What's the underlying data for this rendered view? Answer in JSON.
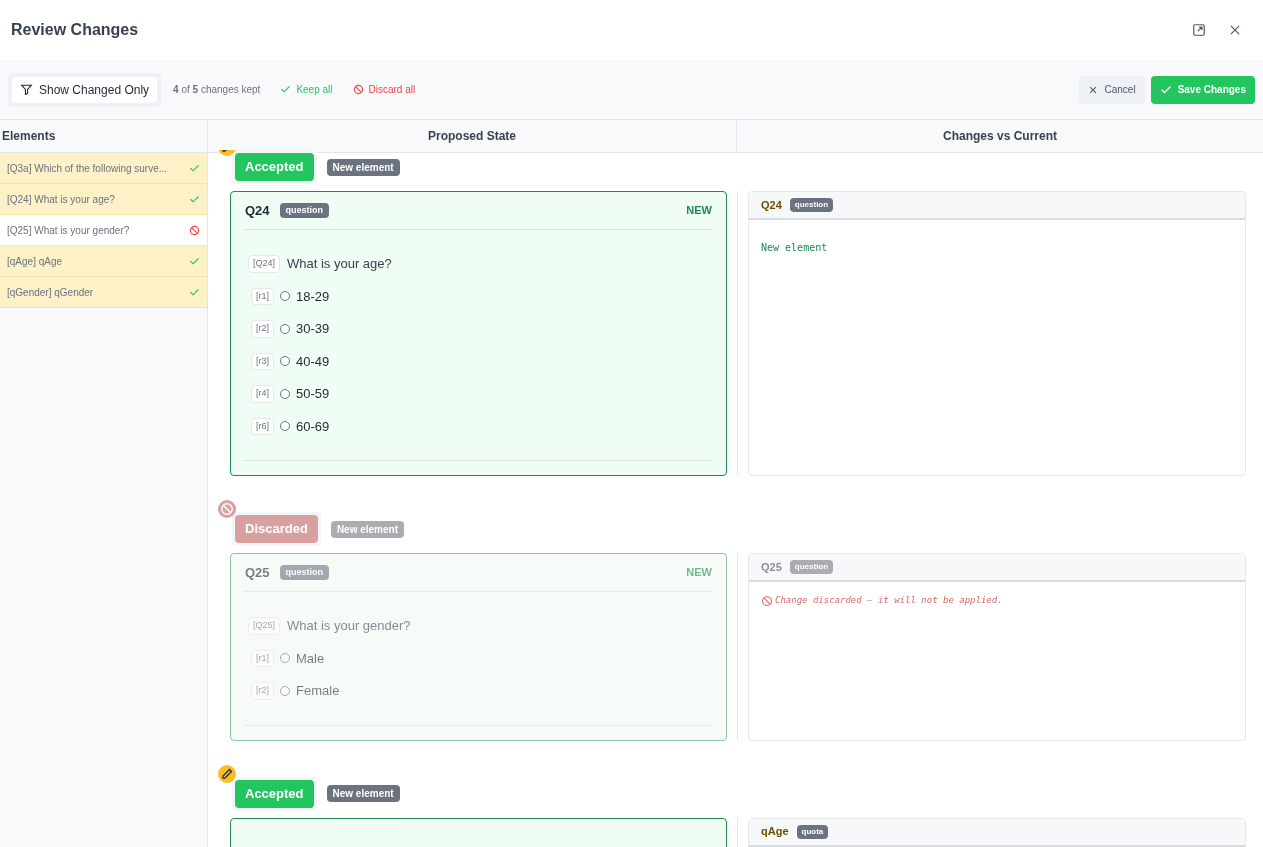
{
  "dialog": {
    "title": "Review Changes"
  },
  "toolbar": {
    "filter_button": "Show Changed Only",
    "summary": "**4** of **5** changes kept",
    "keep_all": "Keep all",
    "discard_all": "Discard all",
    "cancel": "Cancel",
    "save": "Save Changes"
  },
  "columns": [
    "Elements",
    "Proposed State",
    "Changes vs Current"
  ],
  "elements": [
    {
      "label": "[Q3a] Which of the following surve...",
      "kept": true
    },
    {
      "label": "[Q24] What is your age?",
      "kept": true
    },
    {
      "label": "[Q25] What is your gender?",
      "kept": false
    },
    {
      "label": "[qAge] qAge",
      "kept": true
    },
    {
      "label": "[qGender] qGender",
      "kept": true
    }
  ],
  "changes": [
    {
      "kind": "accepted",
      "status": "Accepted",
      "tag": "New element",
      "proposed": {
        "id": "Q24",
        "type": "question",
        "badge": "NEW",
        "question_code": "[Q24]",
        "question": "What is your age?",
        "options": [
          {
            "code": "[r1]",
            "label": "18-29",
            "selected": false
          },
          {
            "code": "[r2]",
            "label": "30-39",
            "selected": false
          },
          {
            "code": "[r3]",
            "label": "40-49",
            "selected": false
          },
          {
            "code": "[r4]",
            "label": "50-59",
            "selected": false
          },
          {
            "code": "[r6]",
            "label": "60-69",
            "selected": false
          }
        ]
      },
      "diff": {
        "id": "Q24",
        "type": "question",
        "kind": "new",
        "text": "New element"
      }
    },
    {
      "kind": "discarded",
      "status": "Discarded",
      "tag": "New element",
      "proposed": {
        "id": "Q25",
        "type": "question",
        "badge": "NEW",
        "question_code": "[Q25]",
        "question": "What is your gender?",
        "options": [
          {
            "code": "[r1]",
            "label": "Male",
            "selected": false
          },
          {
            "code": "[r2]",
            "label": "Female",
            "selected": false
          }
        ]
      },
      "diff": {
        "id": "Q25",
        "type": "question",
        "kind": "discarded",
        "text": "Change discarded — it will not be applied."
      }
    },
    {
      "kind": "accepted",
      "status": "Accepted",
      "tag": "New element",
      "diff": {
        "id": "qAge",
        "type": "quota"
      }
    }
  ]
}
